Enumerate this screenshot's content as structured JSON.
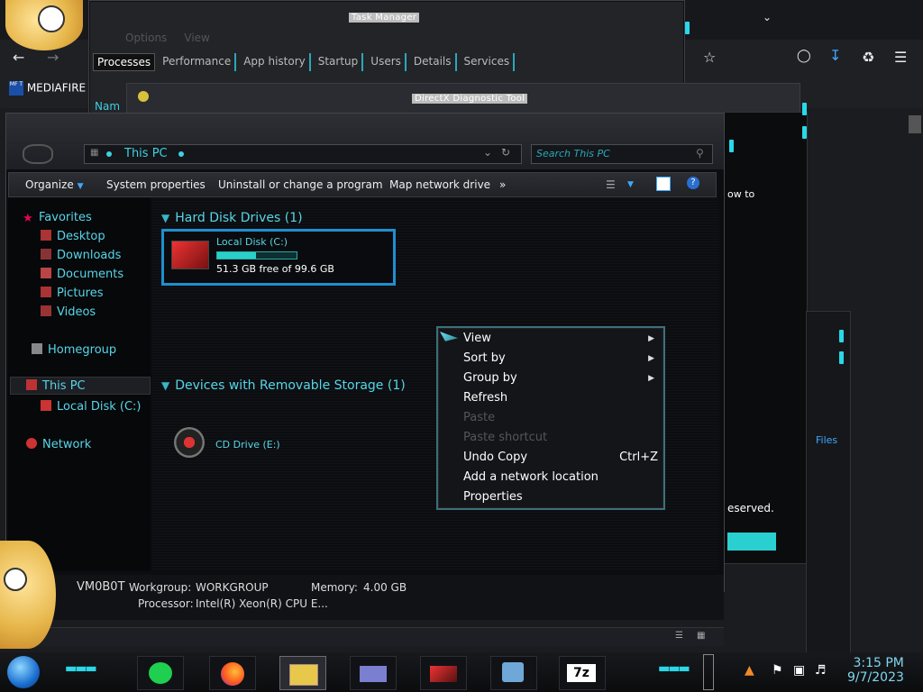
{
  "task_manager": {
    "title": "Task Manager",
    "menu": [
      "Options",
      "View"
    ],
    "tabs": [
      "Processes",
      "Performance",
      "App history",
      "Startup",
      "Users",
      "Details",
      "Services"
    ],
    "column_partial": "Nam"
  },
  "browser": {
    "bookmark_label": "MEDIAFIRE",
    "partial_text_right": "ow to",
    "partial_text_reserved": "eserved.",
    "partial_files": "Files"
  },
  "directx": {
    "title": "DirectX Diagnostic Tool"
  },
  "explorer": {
    "address": "This PC",
    "search_placeholder": "Search This PC",
    "toolbar": {
      "organize": "Organize",
      "system_properties": "System properties",
      "uninstall": "Uninstall or change a program",
      "map_network": "Map network drive",
      "more": "»"
    },
    "nav": {
      "favorites": "Favorites",
      "desktop": "Desktop",
      "downloads": "Downloads",
      "documents": "Documents",
      "pictures": "Pictures",
      "videos": "Videos",
      "homegroup": "Homegroup",
      "this_pc": "This PC",
      "local_disk": "Local Disk (C:)",
      "network": "Network"
    },
    "groups": {
      "hdd": "Hard Disk Drives (1)",
      "removable": "Devices with Removable Storage (1)"
    },
    "local_disk": {
      "name": "Local Disk (C:)",
      "free": "51.3 GB free of 99.6 GB",
      "used_fraction": 0.485
    },
    "cd_drive": "CD Drive (E:)",
    "details": {
      "computer_name": "VM0B0T",
      "workgroup_label": "Workgroup:",
      "workgroup_value": "WORKGROUP",
      "memory_label": "Memory:",
      "memory_value": "4.00 GB",
      "processor_label": "Processor:",
      "processor_value": "Intel(R) Xeon(R) CPU E..."
    }
  },
  "context_menu": {
    "items": [
      {
        "label": "View",
        "submenu": true,
        "enabled": true
      },
      {
        "label": "Sort by",
        "submenu": true,
        "enabled": true
      },
      {
        "label": "Group by",
        "submenu": true,
        "enabled": true
      },
      {
        "label": "Refresh",
        "enabled": true
      },
      {
        "label": "Paste",
        "enabled": false
      },
      {
        "label": "Paste shortcut",
        "enabled": false
      },
      {
        "label": "Undo Copy",
        "shortcut": "Ctrl+Z",
        "enabled": true
      },
      {
        "label": "Add a network location",
        "enabled": true
      },
      {
        "label": "Properties",
        "enabled": true
      }
    ]
  },
  "taskbar": {
    "apps": [
      "start-orb",
      "app-green-icon",
      "firefox-icon",
      "file-explorer-icon",
      "control-panel-icon",
      "graphics-card-icon",
      "network-computer-icon",
      "7zip-icon"
    ],
    "sevenzip_label": "7z",
    "clock_time": "3:15 PM",
    "clock_date": "9/7/2023"
  },
  "colors": {
    "accent": "#3fd0e0",
    "selection_border": "#1e8fd0",
    "disk_bar": "#2ad0c8"
  }
}
